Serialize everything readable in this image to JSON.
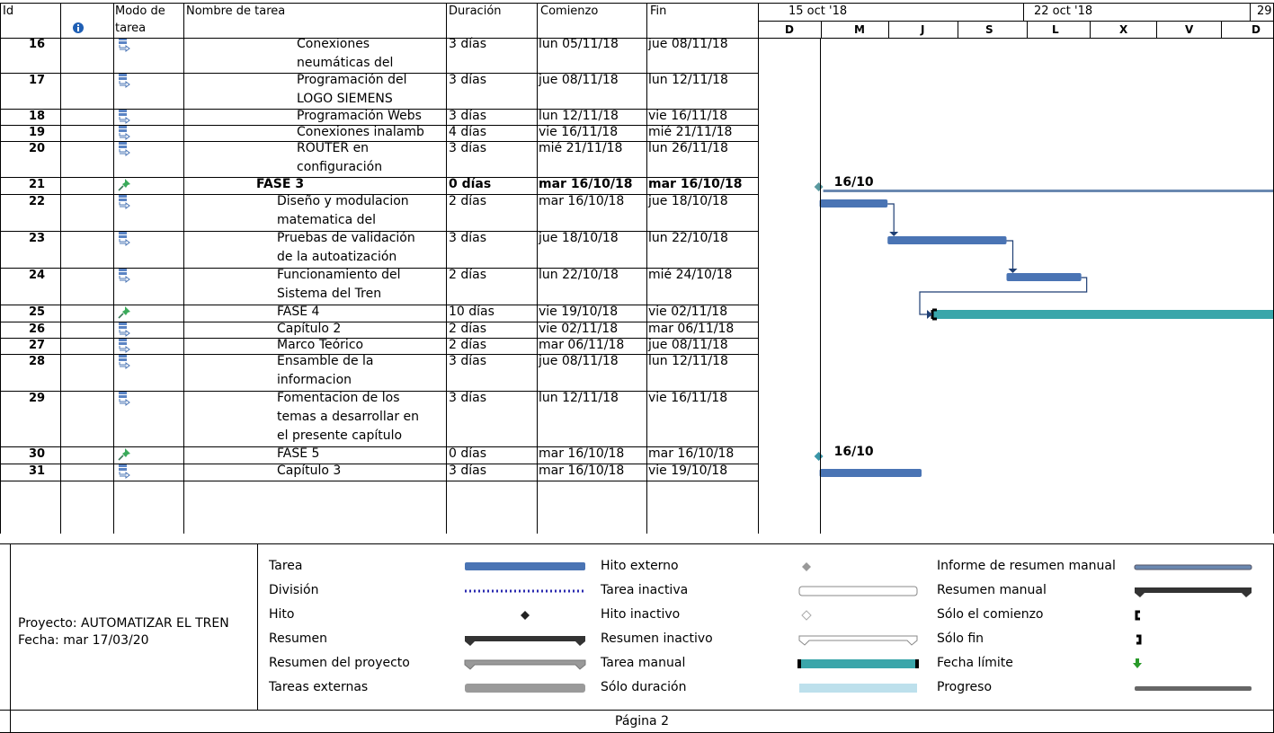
{
  "header": {
    "col_id": "Id",
    "col_mode_line1": "Modo de",
    "col_mode_line2": "tarea",
    "col_name": "Nombre de tarea",
    "col_duration": "Duración",
    "col_start": "Comienzo",
    "col_end": "Fin",
    "week1": "15 oct '18",
    "week2": "22 oct '18",
    "week3": "29",
    "days": [
      "D",
      "M",
      "J",
      "S",
      "L",
      "X",
      "V",
      "D"
    ],
    "info_icon": "info-icon"
  },
  "rows": [
    {
      "id": "16",
      "name": [
        "Conexiones",
        "neumáticas del"
      ],
      "duration": "3 días",
      "start": "lun 05/11/18",
      "end": "jue 08/11/18",
      "mode": "auto",
      "indent": 3,
      "bold": false
    },
    {
      "id": "17",
      "name": [
        "Programación del",
        "LOGO SIEMENS"
      ],
      "duration": "3 días",
      "start": "jue 08/11/18",
      "end": "lun 12/11/18",
      "mode": "auto",
      "indent": 3,
      "bold": false
    },
    {
      "id": "18",
      "name": [
        "Programación Webs"
      ],
      "duration": "3 días",
      "start": "lun 12/11/18",
      "end": "vie 16/11/18",
      "mode": "auto",
      "indent": 3,
      "bold": false
    },
    {
      "id": "19",
      "name": [
        "Conexiones inalamb"
      ],
      "duration": "4 días",
      "start": "vie 16/11/18",
      "end": "mié 21/11/18",
      "mode": "auto",
      "indent": 3,
      "bold": false
    },
    {
      "id": "20",
      "name": [
        "ROUTER en",
        "configuración"
      ],
      "duration": "3 días",
      "start": "mié 21/11/18",
      "end": "lun 26/11/18",
      "mode": "auto",
      "indent": 3,
      "bold": false
    },
    {
      "id": "21",
      "name": [
        "FASE 3"
      ],
      "duration": "0 días",
      "start": "mar 16/10/18",
      "end": "mar 16/10/18",
      "mode": "manual",
      "indent": 1,
      "bold": true
    },
    {
      "id": "22",
      "name": [
        "Diseño y modulacion",
        "matematica del"
      ],
      "duration": "2 días",
      "start": "mar 16/10/18",
      "end": "jue 18/10/18",
      "mode": "auto",
      "indent": 2,
      "bold": false
    },
    {
      "id": "23",
      "name": [
        "Pruebas de validación",
        "de la autoatización"
      ],
      "duration": "3 días",
      "start": "jue 18/10/18",
      "end": "lun 22/10/18",
      "mode": "auto",
      "indent": 2,
      "bold": false
    },
    {
      "id": "24",
      "name": [
        "Funcionamiento del",
        "Sistema del Tren"
      ],
      "duration": "2 días",
      "start": "lun 22/10/18",
      "end": "mié 24/10/18",
      "mode": "auto",
      "indent": 2,
      "bold": false
    },
    {
      "id": "25",
      "name": [
        "FASE 4"
      ],
      "duration": "10 días",
      "start": "vie 19/10/18",
      "end": "vie 02/11/18",
      "mode": "manual",
      "indent": 2,
      "bold": false
    },
    {
      "id": "26",
      "name": [
        "Capítulo 2"
      ],
      "duration": "2 días",
      "start": "vie 02/11/18",
      "end": "mar 06/11/18",
      "mode": "auto",
      "indent": 2,
      "bold": false
    },
    {
      "id": "27",
      "name": [
        "Marco Teórico"
      ],
      "duration": "2 días",
      "start": "mar 06/11/18",
      "end": "jue 08/11/18",
      "mode": "auto",
      "indent": 2,
      "bold": false
    },
    {
      "id": "28",
      "name": [
        "Ensamble de la",
        "informacion"
      ],
      "duration": "3 días",
      "start": "jue 08/11/18",
      "end": "lun 12/11/18",
      "mode": "auto",
      "indent": 2,
      "bold": false
    },
    {
      "id": "29",
      "name": [
        "Fomentacion de los",
        "temas a desarrollar en",
        "el presente capítulo"
      ],
      "duration": "3 días",
      "start": "lun 12/11/18",
      "end": "vie 16/11/18",
      "mode": "auto",
      "indent": 2,
      "bold": false
    },
    {
      "id": "30",
      "name": [
        "FASE 5"
      ],
      "duration": "0 días",
      "start": "mar 16/10/18",
      "end": "mar 16/10/18",
      "mode": "manual",
      "indent": 2,
      "bold": false
    },
    {
      "id": "31",
      "name": [
        "Capítulo 3"
      ],
      "duration": "3 días",
      "start": "mar 16/10/18",
      "end": "vie 19/10/18",
      "mode": "auto",
      "indent": 2,
      "bold": false
    }
  ],
  "chart_data": {
    "type": "gantt",
    "timeline_days": [
      "dom 14/10",
      "lun 15/10",
      "mar 16/10",
      "mié 17/10",
      "jue 18/10",
      "vie 19/10",
      "sáb 20/10",
      "dom 21/10",
      "lun 22/10",
      "mar 23/10",
      "mié 24/10",
      "jue 25/10",
      "vie 26/10",
      "sáb 27/10",
      "dom 28/10"
    ],
    "tasks": [
      {
        "id": "21",
        "kind": "milestone_summary",
        "start_day": 2.0,
        "label": "16/10",
        "extends_past_view": true
      },
      {
        "id": "22",
        "kind": "task",
        "start_day": 2.0,
        "end_day": 4.0
      },
      {
        "id": "23",
        "kind": "task",
        "start_day": 4.0,
        "end_day": 7.5
      },
      {
        "id": "24",
        "kind": "task",
        "start_day": 7.5,
        "end_day": 9.7
      },
      {
        "id": "25",
        "kind": "manual_task",
        "start_day": 5.0,
        "extends_past_view": true
      },
      {
        "id": "30",
        "kind": "milestone",
        "start_day": 2.0,
        "label": "16/10"
      },
      {
        "id": "31",
        "kind": "task",
        "start_day": 2.0,
        "end_day": 5.0
      }
    ],
    "links": [
      {
        "from": "22",
        "to": "23"
      },
      {
        "from": "23",
        "to": "24"
      },
      {
        "from": "24",
        "to": "25"
      }
    ]
  },
  "legend": {
    "project": "Proyecto: AUTOMATIZAR EL TREN",
    "date": "Fecha: mar 17/03/20",
    "col1": [
      "Tarea",
      "División",
      "Hito",
      "Resumen",
      "Resumen del proyecto",
      "Tareas externas"
    ],
    "col2": [
      "Hito externo",
      "Tarea inactiva",
      "Hito inactivo",
      "Resumen inactivo",
      "Tarea manual",
      "Sólo duración"
    ],
    "col3": [
      "Informe de resumen manual",
      "Resumen manual",
      "Sólo el comienzo",
      "Sólo fin",
      "Fecha límite",
      "Progreso"
    ]
  },
  "footer": {
    "page": "Página 2"
  },
  "colors": {
    "task_blue": "#4a74b4",
    "manual_teal": "#3aa6aa",
    "link": "#1f3f74",
    "grid": "#000000"
  }
}
